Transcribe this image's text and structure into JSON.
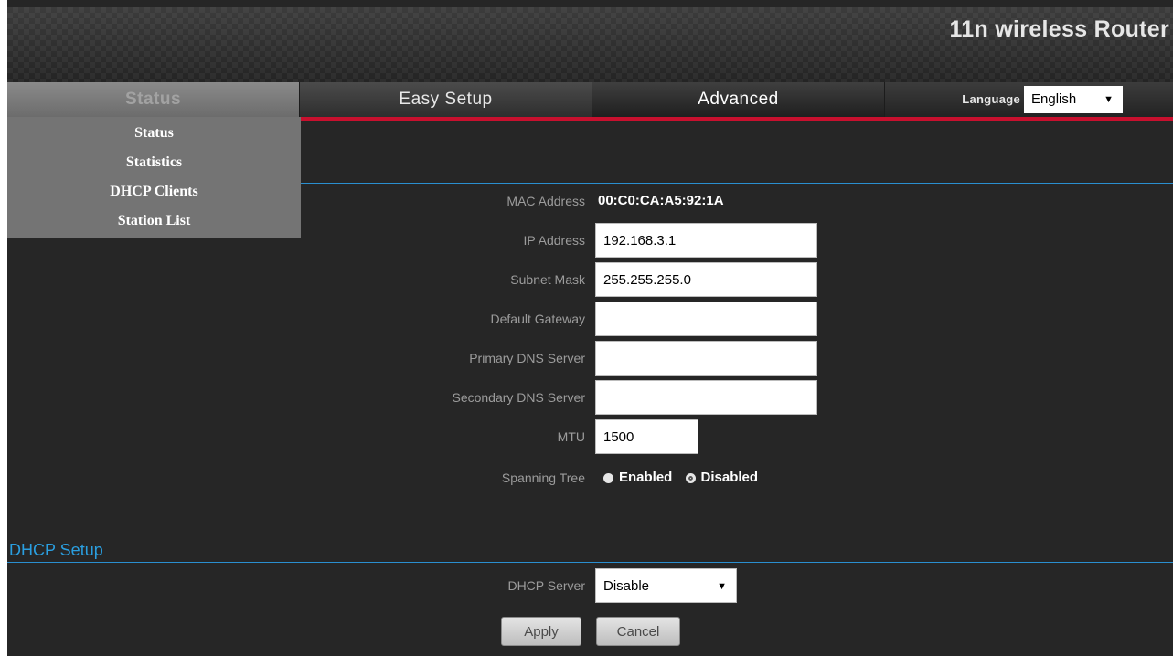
{
  "header": {
    "brand": "11n wireless Router"
  },
  "nav": {
    "tabs": [
      {
        "label": "Status"
      },
      {
        "label": "Easy Setup"
      },
      {
        "label": "Advanced"
      }
    ],
    "language_label": "Language",
    "language_value": "English"
  },
  "submenu": {
    "items": [
      {
        "label": "Status"
      },
      {
        "label": "Statistics"
      },
      {
        "label": "DHCP Clients"
      },
      {
        "label": "Station List"
      }
    ]
  },
  "lan": {
    "mac_label": "MAC Address",
    "mac_value": "00:C0:CA:A5:92:1A",
    "ip_label": "IP Address",
    "ip_value": "192.168.3.1",
    "subnet_label": "Subnet Mask",
    "subnet_value": "255.255.255.0",
    "gateway_label": "Default Gateway",
    "gateway_value": "",
    "dns1_label": "Primary DNS Server",
    "dns1_value": "",
    "dns2_label": "Secondary DNS Server",
    "dns2_value": "",
    "mtu_label": "MTU",
    "mtu_value": "1500",
    "stp_label": "Spanning Tree",
    "stp_options": [
      "Enabled",
      "Disabled"
    ],
    "stp_selected": "Disabled"
  },
  "dhcp": {
    "section_title": "DHCP Setup",
    "server_label": "DHCP Server",
    "server_value": "Disable"
  },
  "buttons": {
    "apply": "Apply",
    "cancel": "Cancel"
  },
  "colors": {
    "accent_red": "#c8102e",
    "accent_blue": "#2a9fe0",
    "background": "#262626"
  }
}
